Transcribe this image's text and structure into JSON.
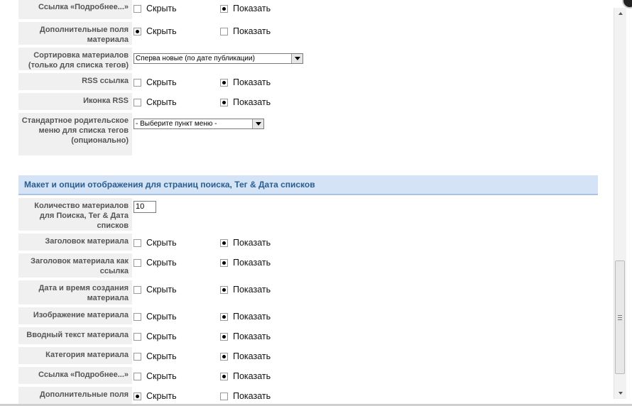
{
  "labels": {
    "hide": "Скрыть",
    "show": "Показать"
  },
  "rows_top": [
    {
      "label": "Ссылка «Подробнее...»",
      "selected": "show"
    },
    {
      "label": "Дополнительные поля материала",
      "selected": "hide"
    }
  ],
  "sort": {
    "label": "Сортировка материалов (только для списка тегов)",
    "value": "Сперва новые (по дате публикации)"
  },
  "rss_rows": [
    {
      "label": "RSS ссылка",
      "selected": "show"
    },
    {
      "label": "Иконка RSS",
      "selected": "show"
    }
  ],
  "parent_menu": {
    "label": "Стандартное родительское меню для списка тегов (опционально)",
    "value": "- Выберите пункт меню -"
  },
  "section": {
    "title": "Макет и опции отображения для страниц поиска, Тег & Дата списков"
  },
  "count": {
    "label": "Количество материалов для Поиска, Тег & Дата списков",
    "value": "10"
  },
  "rows_bottom": [
    {
      "label": "Заголовок материала",
      "selected": "show"
    },
    {
      "label": "Заголовок материала как ссылка",
      "selected": "show"
    },
    {
      "label": "Дата и время создания материала",
      "selected": "show"
    },
    {
      "label": "Изображение материала",
      "selected": "show"
    },
    {
      "label": "Вводный текст материала",
      "selected": "show"
    },
    {
      "label": "Категория материала",
      "selected": "show"
    },
    {
      "label": "Ссылка «Подробнее...»",
      "selected": "show"
    },
    {
      "label": "Дополнительные поля",
      "selected": "hide"
    }
  ],
  "colors": {
    "section_bg": "#d4e4f6",
    "section_text": "#2a5c8f",
    "label_bg": "#f0f0f0"
  }
}
